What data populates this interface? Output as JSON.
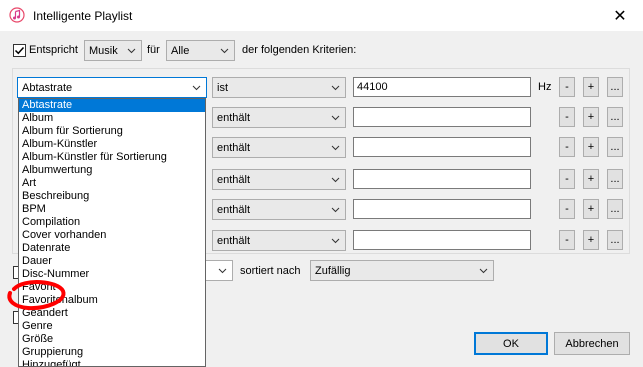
{
  "window": {
    "title": "Intelligente Playlist",
    "close_symbol": "✕"
  },
  "top": {
    "match_label": "Entspricht",
    "match_checked": true,
    "media_value": "Musik",
    "for_label": "für",
    "scope_value": "Alle",
    "suffix_label": "der folgenden Kriterien:"
  },
  "rules": [
    {
      "field": "Abtastrate",
      "operator": "ist",
      "value": "44100",
      "unit": "Hz",
      "minus_enabled": true
    },
    {
      "field": "",
      "operator": "enthält",
      "value": "",
      "unit": "",
      "minus_enabled": true
    },
    {
      "field": "",
      "operator": "enthält",
      "value": "",
      "unit": "",
      "minus_enabled": true
    },
    {
      "field": "",
      "operator": "enthält",
      "value": "",
      "unit": "",
      "minus_enabled": true
    },
    {
      "field": "",
      "operator": "enthält",
      "value": "",
      "unit": "",
      "minus_enabled": true
    },
    {
      "field": "",
      "operator": "enthält",
      "value": "",
      "unit": "",
      "minus_enabled": true
    }
  ],
  "rule_buttons": {
    "minus": "-",
    "plus": "+",
    "more": "..."
  },
  "dropdown_items": [
    "Abtastrate",
    "Album",
    "Album für Sortierung",
    "Album-Künstler",
    "Album-Künstler für Sortierung",
    "Albumwertung",
    "Art",
    "Beschreibung",
    "BPM",
    "Compilation",
    "Cover vorhanden",
    "Datenrate",
    "Dauer",
    "Disc-Nummer",
    "Favorit",
    "Favoritenalbum",
    "Geändert",
    "Genre",
    "Größe",
    "Gruppierung",
    "Hinzugefügt"
  ],
  "dropdown_selected": 0,
  "sort": {
    "label": "sortiert nach",
    "value": "Zufällig"
  },
  "buttons": {
    "ok": "OK",
    "cancel": "Abbrechen"
  },
  "colors": {
    "accent": "#0078d7",
    "annotation": "#ff0000",
    "dialog_bg": "#f0f0f0"
  }
}
